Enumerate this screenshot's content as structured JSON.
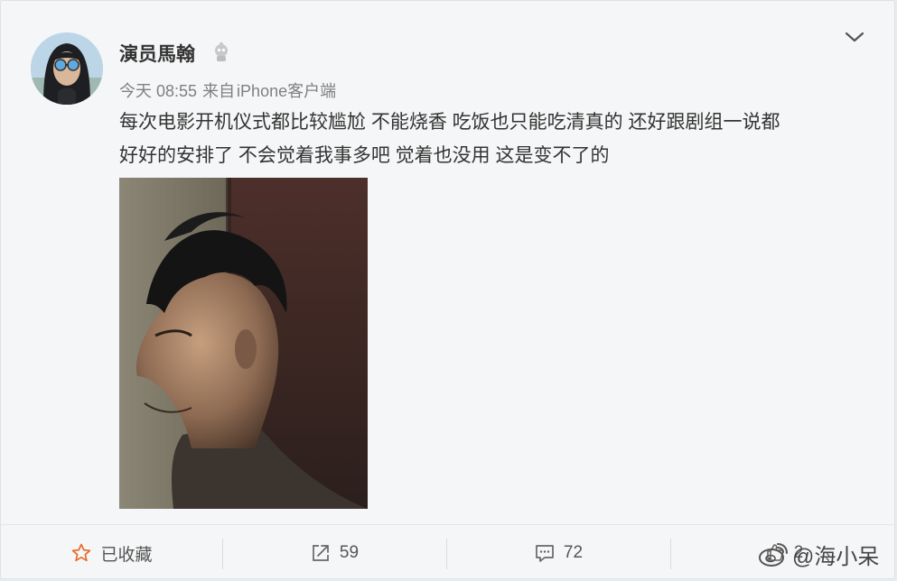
{
  "post": {
    "username": "演员馬翰",
    "time": "今天 08:55",
    "source_prefix": "来自",
    "source": "iPhone客户端",
    "text_line1": "每次电影开机仪式都比较尴尬 不能烧香 吃饭也只能吃清真的 还好跟剧组一说都",
    "text_line2": "好好的安排了 不会觉着我事多吧 觉着也没用 这是变不了的"
  },
  "icons": {
    "badge": "verified-badge-icon",
    "menu": "chevron-down-icon",
    "favorite": "star-outline-icon",
    "share": "share-icon",
    "comment": "comment-icon",
    "like": "thumb-up-icon"
  },
  "actions": {
    "favorite_label": "已收藏",
    "share_count": "59",
    "comment_count": "72",
    "like_count": "2"
  },
  "watermark": {
    "text": "@海小呆"
  },
  "colors": {
    "card_bg": "#f5f6f7",
    "accent": "#e86b2a",
    "meta": "#808080"
  }
}
